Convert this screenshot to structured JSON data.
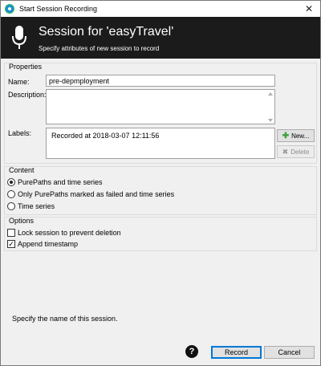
{
  "window": {
    "title": "Start Session Recording",
    "close_glyph": "✕"
  },
  "header": {
    "title": "Session for 'easyTravel'",
    "subtitle": "Specify attributes of new session to record",
    "icon": "microphone-icon",
    "background": "#1b1b1b"
  },
  "properties": {
    "group_title": "Properties",
    "name_label": "Name:",
    "name_value": "pre-depmployment",
    "description_label": "Description:",
    "description_value": "",
    "labels_label": "Labels:",
    "labels_value": "Recorded at 2018-03-07 12:11:56",
    "new_button": "New...",
    "delete_button": "Delete"
  },
  "content": {
    "group_title": "Content",
    "options": [
      {
        "label": "PurePaths and time series",
        "selected": true
      },
      {
        "label": "Only PurePaths marked as failed and time series",
        "selected": false
      },
      {
        "label": "Time series",
        "selected": false
      }
    ]
  },
  "options": {
    "group_title": "Options",
    "lock_label": "Lock session to prevent deletion",
    "lock_checked": false,
    "append_label": "Append timestamp",
    "append_checked": true
  },
  "hint": "Specify the name of this session.",
  "footer": {
    "help": "?",
    "record_button": "Record",
    "cancel_button": "Cancel"
  }
}
